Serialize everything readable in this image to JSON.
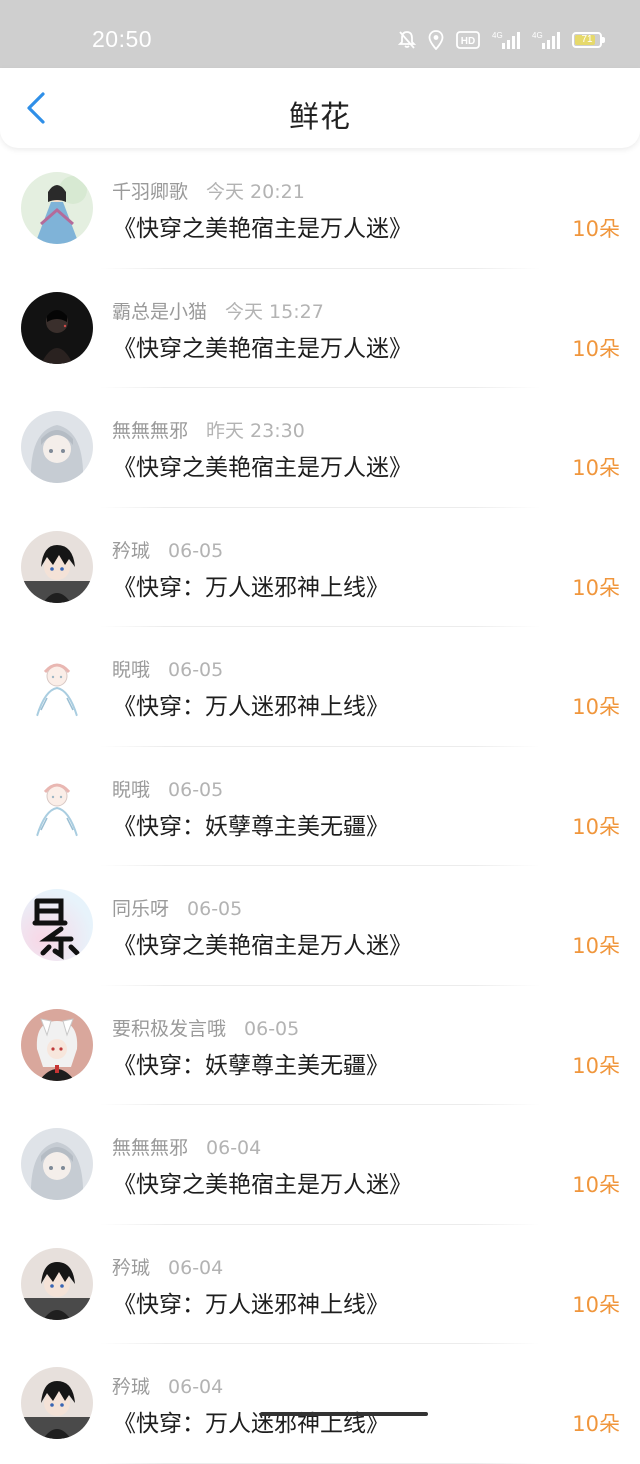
{
  "status_bar": {
    "time": "20:50",
    "icons": [
      "bell-off-icon",
      "location-icon",
      "hd-icon",
      "signal-4g-icon",
      "signal-4g-icon",
      "battery-icon"
    ],
    "battery_level": "71"
  },
  "header": {
    "back_icon": "chevron-left-icon",
    "title": "鲜花"
  },
  "colors": {
    "accent_blue": "#2f8fe8",
    "amount_orange": "#f0963c",
    "meta_gray": "#9a9a9a"
  },
  "items": [
    {
      "user": "千羽卿歌",
      "time": "今天 20:21",
      "book": "《快穿之美艳宿主是万人迷》",
      "amount": "10朵",
      "avatar": "avatar-qianyu"
    },
    {
      "user": "霸总是小猫",
      "time": "今天 15:27",
      "book": "《快穿之美艳宿主是万人迷》",
      "amount": "10朵",
      "avatar": "avatar-dark"
    },
    {
      "user": "無無無邪",
      "time": "昨天 23:30",
      "book": "《快穿之美艳宿主是万人迷》",
      "amount": "10朵",
      "avatar": "avatar-white-hair"
    },
    {
      "user": "矜珹",
      "time": "06-05",
      "book": "《快穿：万人迷邪神上线》",
      "amount": "10朵",
      "avatar": "avatar-dark-hair-boy"
    },
    {
      "user": "睨哦",
      "time": "06-05",
      "book": "《快穿：万人迷邪神上线》",
      "amount": "10朵",
      "avatar": "avatar-sketch"
    },
    {
      "user": "睨哦",
      "time": "06-05",
      "book": "《快穿：妖孽尊主美无疆》",
      "amount": "10朵",
      "avatar": "avatar-sketch"
    },
    {
      "user": "同乐呀",
      "time": "06-05",
      "book": "《快穿之美艳宿主是万人迷》",
      "amount": "10朵",
      "avatar": "avatar-calligraphy"
    },
    {
      "user": "要积极发言哦",
      "time": "06-05",
      "book": "《快穿：妖孽尊主美无疆》",
      "amount": "10朵",
      "avatar": "avatar-fox"
    },
    {
      "user": "無無無邪",
      "time": "06-04",
      "book": "《快穿之美艳宿主是万人迷》",
      "amount": "10朵",
      "avatar": "avatar-white-hair"
    },
    {
      "user": "矜珹",
      "time": "06-04",
      "book": "《快穿：万人迷邪神上线》",
      "amount": "10朵",
      "avatar": "avatar-dark-hair-boy"
    },
    {
      "user": "矜珹",
      "time": "06-04",
      "book": "《快穿：万人迷邪神上线》",
      "amount": "10朵",
      "avatar": "avatar-dark-hair-boy"
    }
  ]
}
